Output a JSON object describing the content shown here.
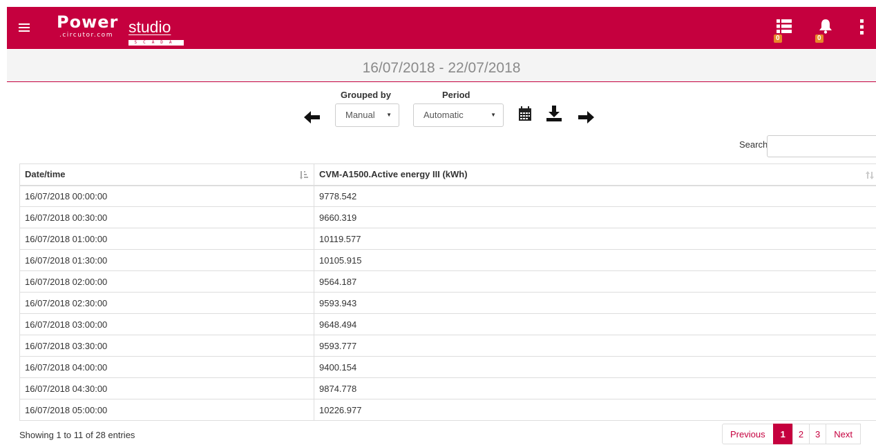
{
  "header": {
    "logo_power": "Power",
    "logo_studio": "studio",
    "logo_circutor": ".circutor.com",
    "logo_scada": "SCADA",
    "events_badge": "0",
    "alarms_badge": "0"
  },
  "date_range": "16/07/2018 - 22/07/2018",
  "toolbar": {
    "grouped_by_label": "Grouped by",
    "grouped_by_value": "Manual",
    "period_label": "Period",
    "period_value": "Automatic",
    "icons": [
      "arrow-left-icon",
      "calendar-icon",
      "download-icon",
      "arrow-right-icon"
    ]
  },
  "search": {
    "label": "Search",
    "value": ""
  },
  "table": {
    "columns": [
      "Date/time",
      "CVM-A1500.Active energy III (kWh)"
    ],
    "rows": [
      [
        "16/07/2018 00:00:00",
        "9778.542"
      ],
      [
        "16/07/2018 00:30:00",
        "9660.319"
      ],
      [
        "16/07/2018 01:00:00",
        "10119.577"
      ],
      [
        "16/07/2018 01:30:00",
        "10105.915"
      ],
      [
        "16/07/2018 02:00:00",
        "9564.187"
      ],
      [
        "16/07/2018 02:30:00",
        "9593.943"
      ],
      [
        "16/07/2018 03:00:00",
        "9648.494"
      ],
      [
        "16/07/2018 03:30:00",
        "9593.777"
      ],
      [
        "16/07/2018 04:00:00",
        "9400.154"
      ],
      [
        "16/07/2018 04:30:00",
        "9874.778"
      ],
      [
        "16/07/2018 05:00:00",
        "10226.977"
      ]
    ]
  },
  "footer": {
    "info": "Showing 1 to 11 of 28 entries",
    "previous": "Previous",
    "pages": [
      "1",
      "2",
      "3"
    ],
    "next": "Next"
  },
  "colors": {
    "brand": "#c5003e",
    "badge": "#e8872a"
  }
}
